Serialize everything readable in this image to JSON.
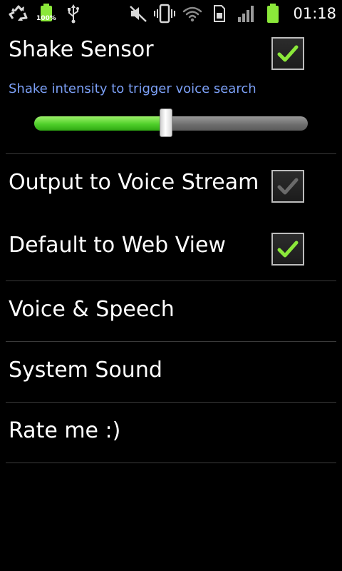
{
  "status_bar": {
    "battery_left_label": "100%",
    "clock": "01:18",
    "icons": [
      "recycle-icon",
      "battery-full-icon",
      "usb-icon",
      "mute-icon",
      "vibrate-icon",
      "wifi-icon",
      "sim-card-icon",
      "signal-icon",
      "battery-icon"
    ]
  },
  "preferences": {
    "shake_sensor": {
      "title": "Shake Sensor",
      "checked": true,
      "summary": "Shake intensity to trigger voice search",
      "slider_fraction": 0.5
    },
    "output_voice_stream": {
      "title": "Output to Voice Stream",
      "checked": false
    },
    "default_web_view": {
      "title": "Default to Web View",
      "checked": true
    },
    "voice_speech": {
      "title": "Voice & Speech"
    },
    "system_sound": {
      "title": "System Sound"
    },
    "rate_me": {
      "title": "Rate me :)"
    }
  },
  "colors": {
    "background": "#000000",
    "summary_text": "#7b9ff5",
    "check_active": "#8be83a",
    "check_inactive": "#6a6a6a",
    "slider_fill": "#4fcf2a"
  }
}
